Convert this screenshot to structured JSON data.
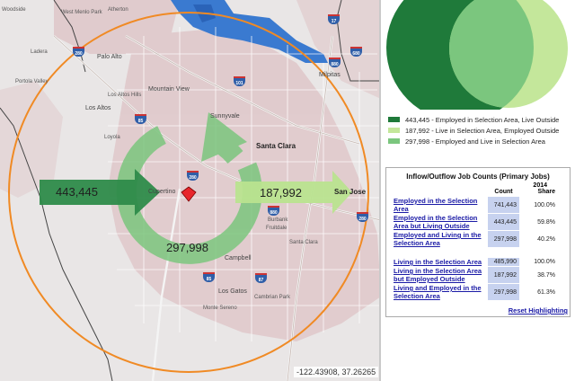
{
  "map": {
    "cities": [
      {
        "id": "woodside",
        "label": "Woodside",
        "class": "tiny"
      },
      {
        "id": "westmenlo",
        "label": "West Menlo Park",
        "class": "tiny"
      },
      {
        "id": "atherton",
        "label": "Atherton",
        "class": "tiny"
      },
      {
        "id": "ladera",
        "label": "Ladera",
        "class": "tiny"
      },
      {
        "id": "paloalto",
        "label": "Palo Alto",
        "class": ""
      },
      {
        "id": "portola",
        "label": "Portola Valley",
        "class": "tiny"
      },
      {
        "id": "losaltoshills",
        "label": "Los Altos Hills",
        "class": "tiny"
      },
      {
        "id": "mountainview",
        "label": "Mountain View",
        "class": ""
      },
      {
        "id": "losaltos",
        "label": "Los Altos",
        "class": ""
      },
      {
        "id": "sunnyvale",
        "label": "Sunnyvale",
        "class": ""
      },
      {
        "id": "loyola",
        "label": "Loyola",
        "class": "tiny"
      },
      {
        "id": "milpitas",
        "label": "Milpitas",
        "class": ""
      },
      {
        "id": "santaclara",
        "label": "Santa Clara",
        "class": "big"
      },
      {
        "id": "cupertino",
        "label": "Cupertino",
        "class": ""
      },
      {
        "id": "sanjose",
        "label": "San Jose",
        "class": "big"
      },
      {
        "id": "burbank",
        "label": "Burbank",
        "class": "tiny"
      },
      {
        "id": "fruitdale",
        "label": "Fruitdale",
        "class": "tiny"
      },
      {
        "id": "santaclara2",
        "label": "Santa Clara",
        "class": "tiny"
      },
      {
        "id": "campbell",
        "label": "Campbell",
        "class": ""
      },
      {
        "id": "losgatos",
        "label": "Los Gatos",
        "class": ""
      },
      {
        "id": "cambrian",
        "label": "Cambrian Park",
        "class": "tiny"
      },
      {
        "id": "monteserenc",
        "label": "Monte Sereno",
        "class": "tiny"
      }
    ],
    "shields": [
      "280",
      "280",
      "880",
      "680",
      "880",
      "280",
      "85",
      "85",
      "87",
      "101",
      "17"
    ],
    "flows": {
      "inflow": "443,445",
      "outflow": "187,992",
      "internal": "297,998"
    },
    "colors": {
      "inflow": "#2e8b4a",
      "outflow": "#b9e38f",
      "internal": "#7bc67e",
      "radius": "#f08a24",
      "marker": "#e8262c"
    },
    "coordinates": "-122.43908, 37.26265"
  },
  "venn": {
    "colors": {
      "left": "#1f7a3a",
      "right": "#c4e79b",
      "overlap": "#7bc67e"
    }
  },
  "legend": [
    {
      "count": "443,445",
      "text": "443,445 - Employed in Selection Area, Live Outside",
      "color": "#1f7a3a"
    },
    {
      "count": "187,992",
      "text": "187,992 - Live in Selection Area, Employed Outside",
      "color": "#c4e79b"
    },
    {
      "count": "297,998",
      "text": "297,998 - Employed and Live in Selection Area",
      "color": "#7bc67e"
    }
  ],
  "table": {
    "title": "Inflow/Outflow Job Counts (Primary Jobs)",
    "year": "2014",
    "col_count": "Count",
    "col_share": "Share",
    "group1": [
      {
        "label": "Employed in the Selection Area",
        "count": "741,443",
        "share": "100.0%"
      },
      {
        "label": "Employed in the Selection Area but Living Outside",
        "count": "443,445",
        "share": "59.8%"
      },
      {
        "label": "Employed and Living in the Selection Area",
        "count": "297,998",
        "share": "40.2%"
      }
    ],
    "group2": [
      {
        "label": "Living in the Selection Area",
        "count": "485,990",
        "share": "100.0%"
      },
      {
        "label": "Living in the Selection Area but Employed Outside",
        "count": "187,992",
        "share": "38.7%"
      },
      {
        "label": "Living and Employed in the Selection Area",
        "count": "297,998",
        "share": "61.3%"
      }
    ],
    "reset": "Reset Highlighting"
  }
}
